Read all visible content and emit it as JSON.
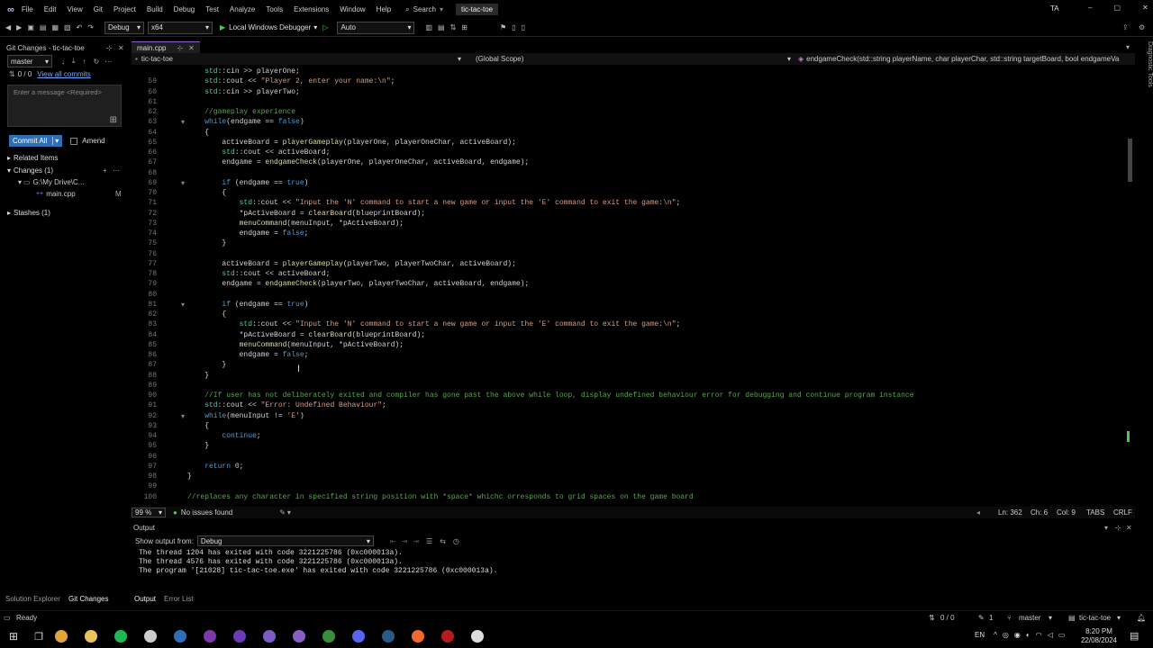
{
  "menubar": {
    "items": [
      "File",
      "Edit",
      "View",
      "Git",
      "Project",
      "Build",
      "Debug",
      "Test",
      "Analyze",
      "Tools",
      "Extensions",
      "Window",
      "Help"
    ],
    "search": "Search",
    "solution": "tic-tac-toe",
    "user": "TA"
  },
  "toolbar": {
    "config": "Debug",
    "platform": "x64",
    "run": "Local Windows Debugger",
    "mode": "Auto"
  },
  "git": {
    "pane_title": "Git Changes - tic-tac-toe",
    "branch": "master",
    "counts": "0 / 0",
    "view_all": "View all commits",
    "message_placeholder": "Enter a message <Required>",
    "commit": "Commit All",
    "amend": "Amend",
    "related": "Related Items",
    "changes": "Changes (1)",
    "folder": "G:\\My Drive\\C...",
    "file": "main.cpp",
    "file_status": "M",
    "stashes": "Stashes (1)"
  },
  "editor": {
    "tab": "main.cpp",
    "project": "tic-tac-toe",
    "scope": "(Global Scope)",
    "function": "endgameCheck(std::string playerName, char playerChar, std::string targetBoard, bool endgameVa",
    "zoom": "99 %",
    "issues": "No issues found",
    "ln": "Ln: 362",
    "ch": "Ch: 6",
    "col": "Col: 9",
    "tabs": "TABS",
    "eol": "CRLF"
  },
  "code": [
    {
      "n": "",
      "t": "    std::cin >> playerOne;"
    },
    {
      "n": "59",
      "t": "    std::cout << \"Player 2, enter your name:\\n\";"
    },
    {
      "n": "60",
      "t": "    std::cin >> playerTwo;"
    },
    {
      "n": "61",
      "t": ""
    },
    {
      "n": "62",
      "t": "    //gameplay experience"
    },
    {
      "n": "63",
      "t": "    while(endgame == false)"
    },
    {
      "n": "64",
      "t": "    {"
    },
    {
      "n": "65",
      "t": "        activeBoard = playerGameplay(playerOne, playerOneChar, activeBoard);"
    },
    {
      "n": "66",
      "t": "        std::cout << activeBoard;"
    },
    {
      "n": "67",
      "t": "        endgame = endgameCheck(playerOne, playerOneChar, activeBoard, endgame);"
    },
    {
      "n": "68",
      "t": ""
    },
    {
      "n": "69",
      "t": "        if (endgame == true)"
    },
    {
      "n": "70",
      "t": "        {"
    },
    {
      "n": "71",
      "t": "            std::cout << \"Input the 'N' command to start a new game or input the 'E' command to exit the game:\\n\";"
    },
    {
      "n": "72",
      "t": "            *pActiveBoard = clearBoard(blueprintBoard);"
    },
    {
      "n": "73",
      "t": "            menuCommand(menuInput, *pActiveBoard);"
    },
    {
      "n": "74",
      "t": "            endgame = false;"
    },
    {
      "n": "75",
      "t": "        }"
    },
    {
      "n": "76",
      "t": ""
    },
    {
      "n": "77",
      "t": "        activeBoard = playerGameplay(playerTwo, playerTwoChar, activeBoard);"
    },
    {
      "n": "78",
      "t": "        std::cout << activeBoard;"
    },
    {
      "n": "79",
      "t": "        endgame = endgameCheck(playerTwo, playerTwoChar, activeBoard, endgame);"
    },
    {
      "n": "80",
      "t": ""
    },
    {
      "n": "81",
      "t": "        if (endgame == true)"
    },
    {
      "n": "82",
      "t": "        {"
    },
    {
      "n": "83",
      "t": "            std::cout << \"Input the 'N' command to start a new game or input the 'E' command to exit the game:\\n\";"
    },
    {
      "n": "84",
      "t": "            *pActiveBoard = clearBoard(blueprintBoard);"
    },
    {
      "n": "85",
      "t": "            menuCommand(menuInput, *pActiveBoard);"
    },
    {
      "n": "86",
      "t": "            endgame = false;"
    },
    {
      "n": "87",
      "t": "        }"
    },
    {
      "n": "88",
      "t": "    }"
    },
    {
      "n": "89",
      "t": ""
    },
    {
      "n": "90",
      "t": "    //If user has not deliberately exited and compiler has gone past the above while loop, display undefined behaviour error for debugging and continue program instance"
    },
    {
      "n": "91",
      "t": "    std::cout << \"Error: Undefined Behaviour\";"
    },
    {
      "n": "92",
      "t": "    while(menuInput != 'E')"
    },
    {
      "n": "93",
      "t": "    {"
    },
    {
      "n": "94",
      "t": "        continue;"
    },
    {
      "n": "95",
      "t": "    }"
    },
    {
      "n": "96",
      "t": ""
    },
    {
      "n": "97",
      "t": "    return 0;"
    },
    {
      "n": "98",
      "t": "}"
    },
    {
      "n": "99",
      "t": ""
    },
    {
      "n": "100",
      "t": "//replaces any character in specified string position with *space* whichc orresponds to grid spaces on the game board"
    }
  ],
  "output": {
    "title": "Output",
    "show_from_label": "Show output from:",
    "source": "Debug",
    "lines": [
      "The thread 1204 has exited with code 3221225786 (0xc000013a).",
      "The thread 4576 has exited with code 3221225786 (0xc000013a).",
      "The program '[21028] tic-tac-toe.exe' has exited with code 3221225786 (0xc000013a)."
    ]
  },
  "bottom_tabs": {
    "left": [
      "Solution Explorer",
      "Git Changes"
    ],
    "right": [
      "Output",
      "Error List"
    ]
  },
  "status": {
    "ready": "Ready",
    "git_counts": "0 / 0",
    "pending": "1",
    "branch": "master",
    "repo": "tic-tac-toe"
  },
  "taskbar": {
    "lang": "EN",
    "time": "8:20 PM",
    "date": "22/08/2024",
    "apps": [
      {
        "name": "chrome",
        "color": "#e0a43a"
      },
      {
        "name": "files",
        "color": "#e8c55a"
      },
      {
        "name": "spotify",
        "color": "#1db954"
      },
      {
        "name": "github",
        "color": "#cccccc"
      },
      {
        "name": "vscode-blue",
        "color": "#2f6fb6"
      },
      {
        "name": "onenote",
        "color": "#7b3aa8"
      },
      {
        "name": "app-purple",
        "color": "#6a3ab8"
      },
      {
        "name": "github-desktop",
        "color": "#7d5cc4"
      },
      {
        "name": "visual-studio",
        "color": "#8661c5"
      },
      {
        "name": "pycharm",
        "color": "#3a8f3a"
      },
      {
        "name": "discord",
        "color": "#5865f2"
      },
      {
        "name": "steam",
        "color": "#2a5b86"
      },
      {
        "name": "brave",
        "color": "#f26a2b"
      },
      {
        "name": "pdf",
        "color": "#b71c1c"
      },
      {
        "name": "app-white",
        "color": "#dddddd"
      }
    ]
  }
}
